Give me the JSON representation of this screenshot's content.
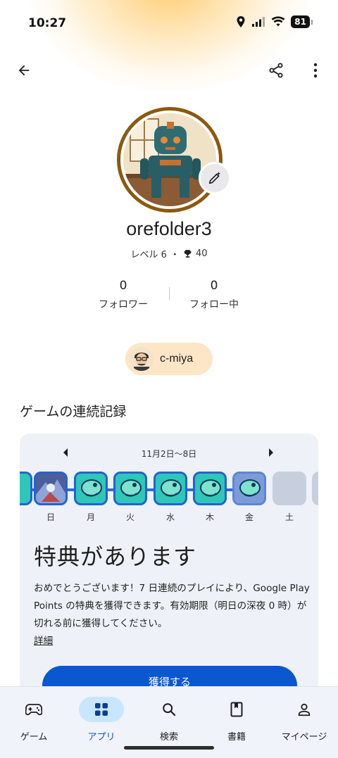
{
  "status_bar": {
    "time": "10:27",
    "battery": "81"
  },
  "profile": {
    "username": "orefolder3",
    "level_label": "レベル 6",
    "separator": "・",
    "trophy_count": "40",
    "followers_count": "0",
    "followers_label": "フォロワー",
    "following_count": "0",
    "following_label": "フォロー中",
    "friend_name": "c-miya"
  },
  "streak": {
    "section_title": "ゲームの連続記録",
    "week_label": "11月2日〜8日",
    "days": [
      "日",
      "月",
      "火",
      "水",
      "木",
      "金",
      "土"
    ]
  },
  "reward": {
    "title": "特典があります",
    "description": "おめでとうございます！7 日連続のプレイにより、Google Play Points の特典を獲得できます。有効期限（明日の深夜 0 時）が切れる前に獲得してください。",
    "details_link": "詳細",
    "claim_button": "獲得する"
  },
  "bottom_nav": {
    "items": [
      {
        "label": "ゲーム",
        "icon": "gamepad-icon"
      },
      {
        "label": "アプリ",
        "icon": "apps-grid-icon"
      },
      {
        "label": "検索",
        "icon": "search-icon"
      },
      {
        "label": "書籍",
        "icon": "book-icon"
      },
      {
        "label": "マイページ",
        "icon": "person-icon"
      }
    ],
    "active_index": 1
  },
  "colors": {
    "accent_blue": "#0b57d0",
    "chip_bg": "#fde6c5",
    "card_bg": "#eef2f8",
    "avatar_ring": "#8a5a10"
  }
}
